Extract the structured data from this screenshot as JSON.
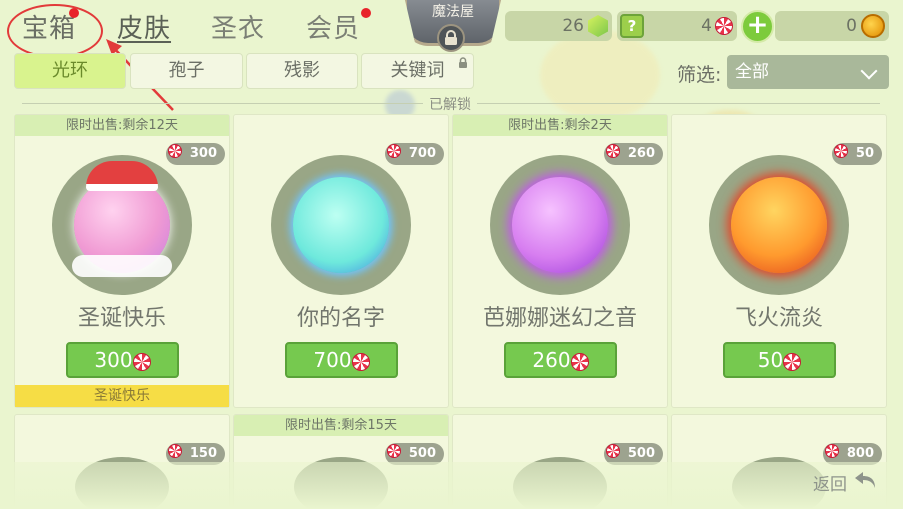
{
  "top_tabs": [
    {
      "label": "宝箱"
    },
    {
      "label": "皮肤"
    },
    {
      "label": "圣衣"
    },
    {
      "label": "会员"
    }
  ],
  "shop_label": "魔法屋",
  "currencies": {
    "gems": "26",
    "lollipops": "4",
    "coins": "0"
  },
  "sub_tabs": [
    {
      "label": "光环"
    },
    {
      "label": "孢子"
    },
    {
      "label": "残影"
    },
    {
      "label": "关键词"
    }
  ],
  "filter": {
    "label": "筛选:",
    "value": "全部"
  },
  "section_label": "已解锁",
  "cards_row1": [
    {
      "sale": "限时出售:剩余12天",
      "price": "300",
      "name": "圣诞快乐",
      "button": "300",
      "footer": "圣诞快乐",
      "orb_color": "#f49ad4"
    },
    {
      "sale": "",
      "price": "700",
      "name": "你的名字",
      "button": "700",
      "orb_color": "#8cf2e0"
    },
    {
      "sale": "限时出售:剩余2天",
      "price": "260",
      "name": "芭娜娜迷幻之音",
      "button": "260",
      "orb_color": "#d77ef0"
    },
    {
      "sale": "",
      "price": "50",
      "name": "飞火流炎",
      "button": "50",
      "orb_color": "#ff9a2e"
    }
  ],
  "cards_row2": [
    {
      "sale": "",
      "price": "150"
    },
    {
      "sale": "限时出售:剩余15天",
      "price": "500"
    },
    {
      "sale": "",
      "price": "500"
    },
    {
      "sale": "",
      "price": "800"
    }
  ],
  "back_label": "返回"
}
